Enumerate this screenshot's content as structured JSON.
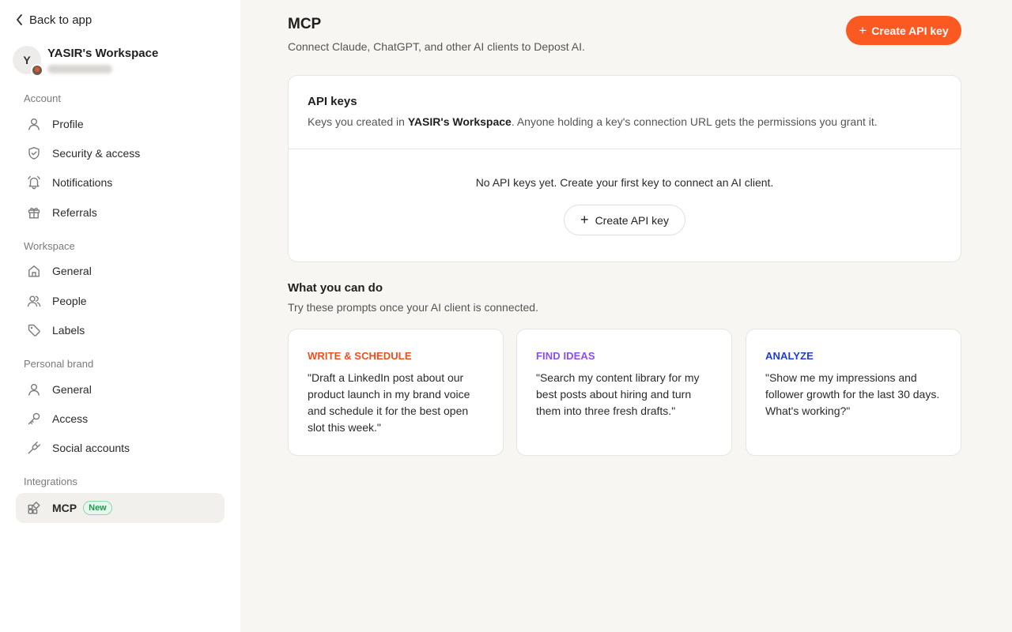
{
  "sidebar": {
    "back_label": "Back to app",
    "workspace": {
      "initial": "Y",
      "name": "YASIR's Workspace"
    },
    "sections": {
      "account": "Account",
      "workspace": "Workspace",
      "personal_brand": "Personal brand",
      "integrations": "Integrations"
    },
    "items": {
      "profile": "Profile",
      "security": "Security & access",
      "notifications": "Notifications",
      "referrals": "Referrals",
      "ws_general": "General",
      "people": "People",
      "labels": "Labels",
      "pb_general": "General",
      "access": "Access",
      "social": "Social accounts",
      "mcp": "MCP",
      "mcp_badge": "New"
    }
  },
  "main": {
    "title": "MCP",
    "subtitle": "Connect Claude, ChatGPT, and other AI clients to Depost AI.",
    "create_button": "Create API key",
    "api_keys": {
      "title": "API keys",
      "desc_prefix": "Keys you created in ",
      "desc_workspace": "YASIR's Workspace",
      "desc_suffix": ". Anyone holding a key's connection URL gets the permissions you grant it.",
      "empty_text": "No API keys yet. Create your first key to connect an AI client.",
      "empty_button": "Create API key"
    },
    "what_you_can_do": {
      "title": "What you can do",
      "subtitle": "Try these prompts once your AI client is connected.",
      "cards": [
        {
          "tag": "WRITE & SCHEDULE",
          "color": "#f04e1e",
          "text": "\"Draft a LinkedIn post about our product launch in my brand voice and schedule it for the best open slot this week.\""
        },
        {
          "tag": "FIND IDEAS",
          "color": "#8b4ef0",
          "text": "\"Search my content library for my best posts about hiring and turn them into three fresh drafts.\""
        },
        {
          "tag": "ANALYZE",
          "color": "#1d3fd1",
          "text": "\"Show me my impressions and follower growth for the last 30 days. What's working?\""
        }
      ]
    }
  },
  "colors": {
    "accent": "#fa5a22",
    "new_badge": "#1e9a4f"
  }
}
